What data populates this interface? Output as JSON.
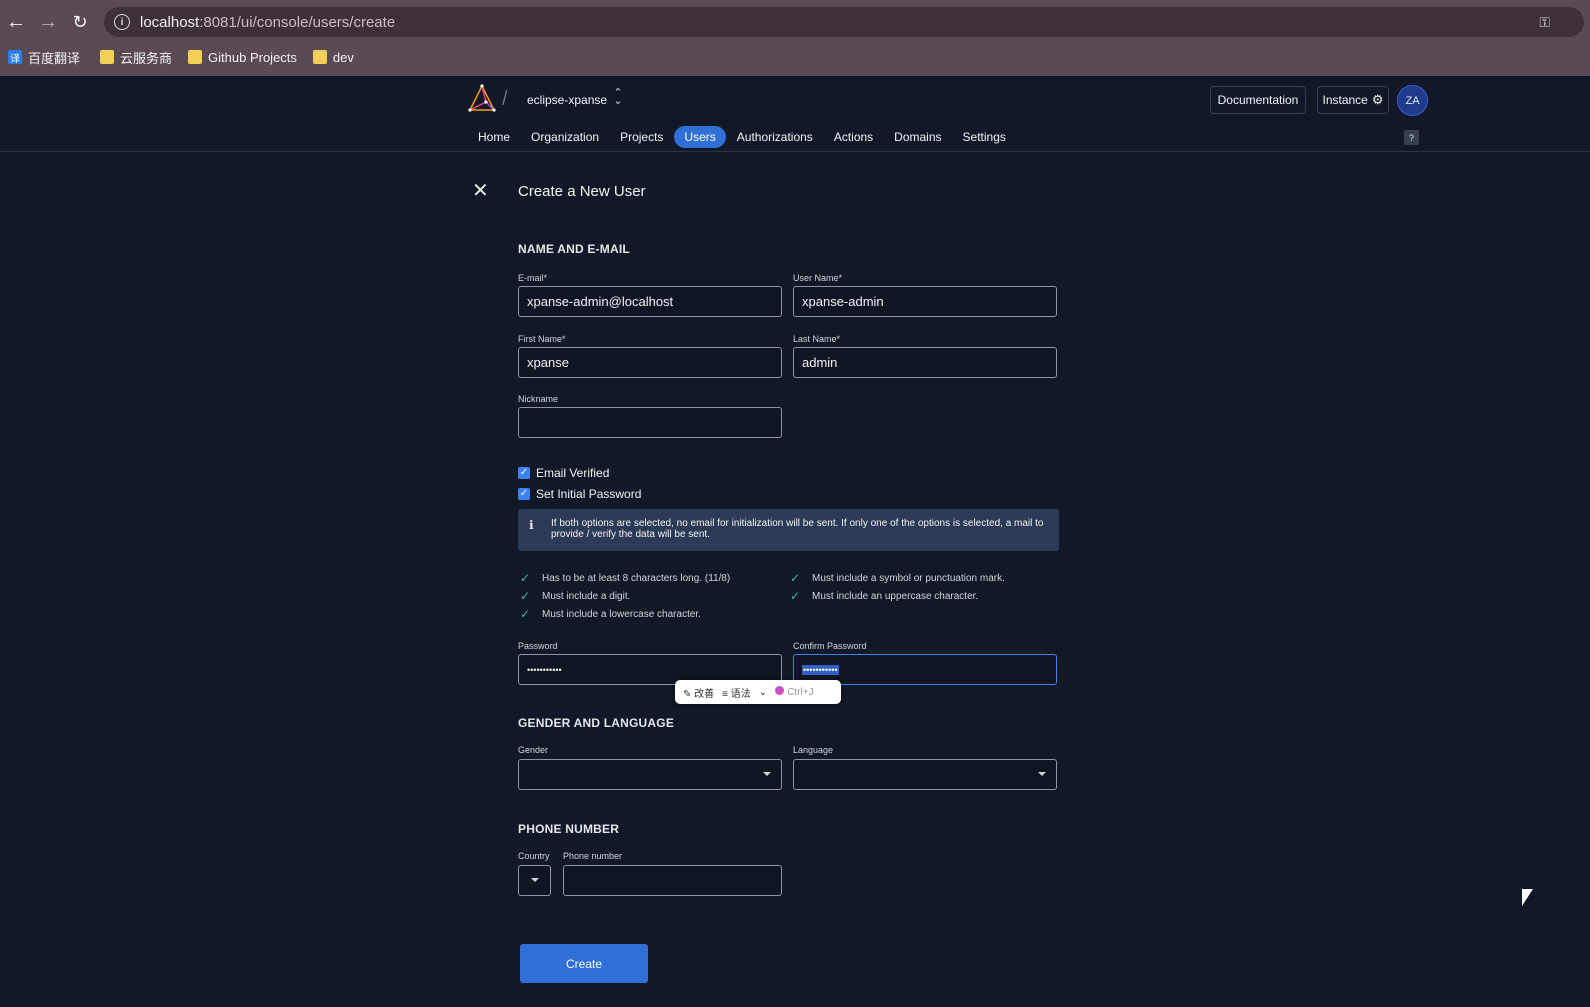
{
  "browser": {
    "url_host": "localhost",
    "url_path": ":8081/ui/console/users/create",
    "bookmarks": [
      {
        "label": "百度翻译",
        "icon": "translate-icon"
      },
      {
        "label": "云服务商",
        "icon": "folder-icon"
      },
      {
        "label": "Github Projects",
        "icon": "folder-icon"
      },
      {
        "label": "dev",
        "icon": "folder-icon"
      }
    ],
    "translate_glyph": "译"
  },
  "header": {
    "org_name": "eclipse-xpanse",
    "documentation_label": "Documentation",
    "instance_label": "Instance",
    "avatar_initials": "ZA",
    "help_label": "?",
    "nav": [
      {
        "label": "Home",
        "active": false
      },
      {
        "label": "Organization",
        "active": false
      },
      {
        "label": "Projects",
        "active": false
      },
      {
        "label": "Users",
        "active": true
      },
      {
        "label": "Authorizations",
        "active": false
      },
      {
        "label": "Actions",
        "active": false
      },
      {
        "label": "Domains",
        "active": false
      },
      {
        "label": "Settings",
        "active": false
      }
    ]
  },
  "form": {
    "title": "Create a New User",
    "section_name_email": "NAME AND E-MAIL",
    "email_label": "E-mail*",
    "email_value": "xpanse-admin@localhost",
    "username_label": "User Name*",
    "username_value": "xpanse-admin",
    "firstname_label": "First Name*",
    "firstname_value": "xpanse",
    "lastname_label": "Last Name*",
    "lastname_value": "admin",
    "nickname_label": "Nickname",
    "nickname_value": "",
    "email_verified_label": "Email Verified",
    "set_password_label": "Set Initial Password",
    "info_text": "If both options are selected, no email for initialization will be sent. If only one of the options is selected, a mail to provide / verify the data will be sent.",
    "requirements": [
      "Has to be at least 8 characters long. (11/8)",
      "Must include a digit.",
      "Must include a lowercase character.",
      "Must include a symbol or punctuation mark.",
      "Must include an uppercase character."
    ],
    "password_label": "Password",
    "password_value": "•••••••••••",
    "confirm_label": "Confirm Password",
    "confirm_value": "•••••••••••",
    "section_gender_lang": "GENDER AND LANGUAGE",
    "gender_label": "Gender",
    "language_label": "Language",
    "section_phone": "PHONE NUMBER",
    "country_label": "Country",
    "phone_label": "Phone number",
    "create_label": "Create"
  },
  "ime_popup": {
    "improve_label": "改善",
    "grammar_label": "语法",
    "shortcut_label": "Ctrl+J"
  },
  "colors": {
    "accent": "#2f6fd6",
    "background": "#111827",
    "success_tick": "#3fb89b"
  }
}
